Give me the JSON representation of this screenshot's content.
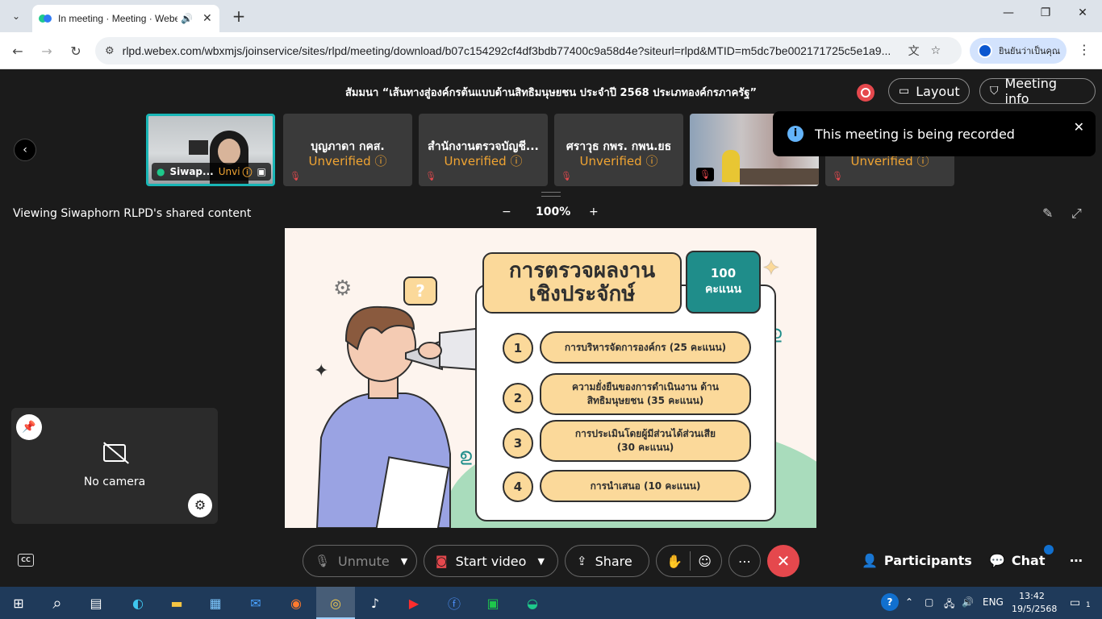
{
  "browser": {
    "tab_title": "In meeting · Meeting · Webex",
    "url": "rlpd.webex.com/wbxmjs/joinservice/sites/rlpd/meeting/download/b07c154292cf4df3bdb77400c9a58d4e?siteurl=rlpd&MTID=m5dc7be002171725c5e1a9...",
    "profile_label": "ยินยันว่าเป็นคุณ"
  },
  "meeting": {
    "title": "สัมมนา “เส้นทางสู่องค์กรต้นแบบด้านสิทธิมนุษยชน ประจำปี 2568 ประเภทองค์กรภาครัฐ”",
    "layout_label": "Layout",
    "info_label": "Meeting info",
    "toast": "This meeting is being recorded",
    "viewing_label": "Viewing Siwaphorn RLPD's shared content",
    "zoom_level": "100%",
    "zoom_out": "−",
    "zoom_in": "+"
  },
  "participants_strip": [
    {
      "name": "Siwap...",
      "status": "Unvi"
    },
    {
      "name": "บุญภาดา กคส.",
      "status": "Unverified"
    },
    {
      "name": "สำนักงานตรวจบัญชี...",
      "status": "Unverified"
    },
    {
      "name": "ศราวุธ กพร. กพน.ยธ",
      "status": "Unverified"
    },
    {
      "name": "",
      "status": ""
    },
    {
      "name": "",
      "status": "Unverified"
    }
  ],
  "slide": {
    "title_line1": "การตรวจผลงาน",
    "title_line2": "เชิงประจักษ์",
    "score_value": "100",
    "score_unit": "คะแนน",
    "items": [
      {
        "num": "1",
        "text": "การบริหารจัดการองค์กร (25 คะแนน)"
      },
      {
        "num": "2",
        "text": "ความยั่งยืนของการดำเนินงาน ด้านสิทธิมนุษยชน (35 คะแนน)"
      },
      {
        "num": "3",
        "text": "การประเมินโดยผู้มีส่วนได้ส่วนเสีย (30 คะแนน)"
      },
      {
        "num": "4",
        "text": "การนำเสนอ (10 คะแนน)"
      }
    ]
  },
  "self_view": {
    "label": "No camera"
  },
  "controls": {
    "unmute": "Unmute",
    "start_video": "Start video",
    "share": "Share",
    "participants": "Participants",
    "chat": "Chat",
    "cc": "CC"
  },
  "taskbar": {
    "language": "ENG",
    "time": "13:42",
    "date": "19/5/2568",
    "notifications": "1"
  },
  "colors": {
    "accent_teal": "#19b6b6",
    "unverified": "#f0a432",
    "end_call": "#e5484d",
    "slide_yellow": "#fbd99a",
    "slide_teal": "#1f8d8a"
  }
}
